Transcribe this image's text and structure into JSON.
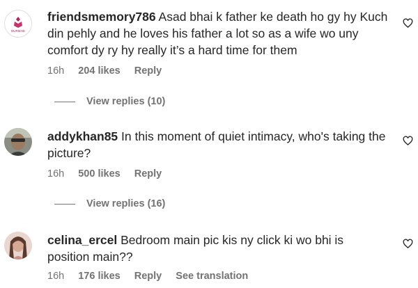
{
  "comments": [
    {
      "username": "friendsmemory786",
      "text": "Asad bhai k father ke death ho gy hy Kuch din pehly and he loves his father a lot so as a wife wo uny comfort dy ry hy really it’s a hard time for them",
      "time": "16h",
      "likes": "204 likes",
      "reply": "Reply",
      "view_replies": "View replies (10)",
      "avatar_text": "DURIESE"
    },
    {
      "username": "addykhan85",
      "text": "In this moment of quiet intimacy, who's taking the picture?",
      "time": "16h",
      "likes": "500 likes",
      "reply": "Reply",
      "view_replies": "View replies (16)"
    },
    {
      "username": "celina_ercel",
      "text": "Bedroom main pic kis ny click ki wo bhi is position main??",
      "time": "16h",
      "likes": "176 likes",
      "reply": "Reply",
      "see_translation": "See translation"
    }
  ],
  "icons": {
    "like": "heart-outline-icon"
  }
}
